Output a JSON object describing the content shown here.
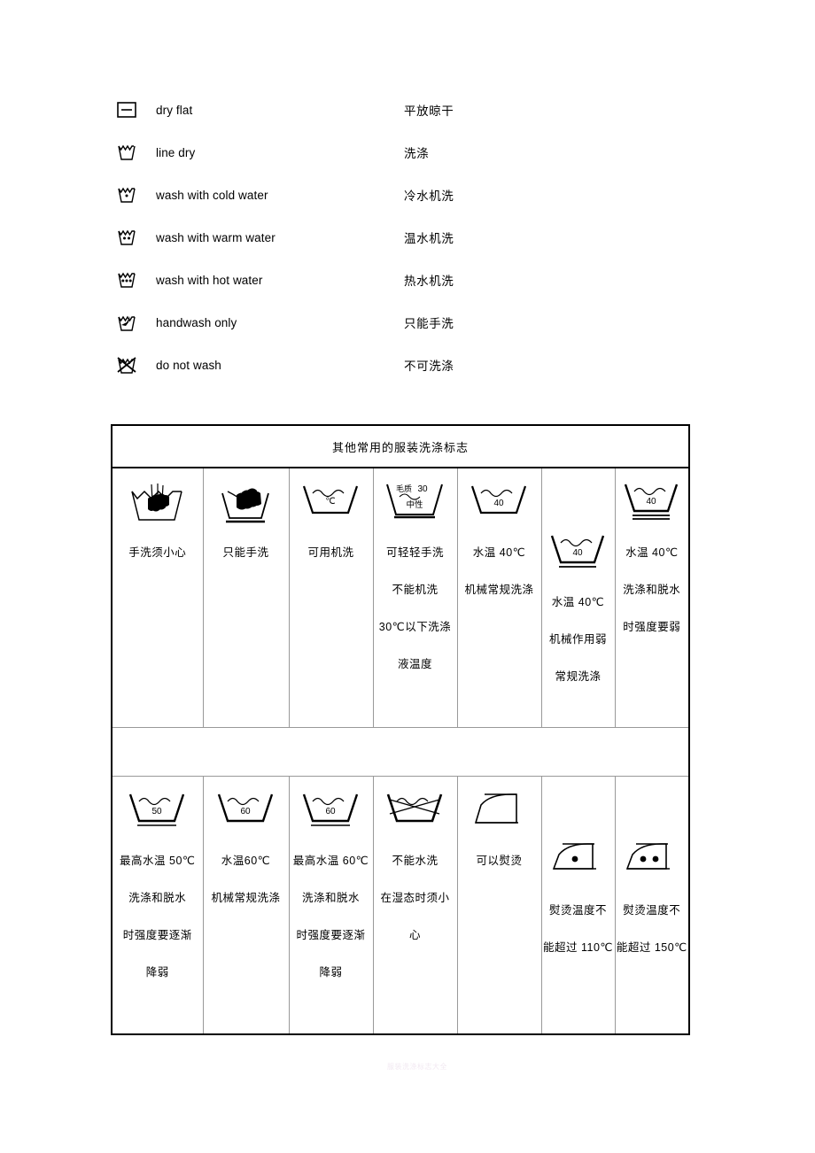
{
  "symbol_list": [
    {
      "icon": "dry-flat-icon",
      "en": "dry flat",
      "zh": "平放晾干"
    },
    {
      "icon": "line-dry-icon",
      "en": "line dry",
      "zh": "洗涤"
    },
    {
      "icon": "wash-cold-water-icon",
      "en": "wash with cold water",
      "zh": "冷水机洗"
    },
    {
      "icon": "wash-warm-water-icon",
      "en": "wash with warm water",
      "zh": "温水机洗"
    },
    {
      "icon": "wash-hot-water-icon",
      "en": "wash with hot water",
      "zh": "热水机洗"
    },
    {
      "icon": "handwash-only-icon",
      "en": "handwash only",
      "zh": "只能手洗"
    },
    {
      "icon": "do-not-wash-icon",
      "en": "do not wash",
      "zh": "不可洗涤"
    }
  ],
  "table": {
    "title": "其他常用的服装洗涤标志",
    "row1": [
      {
        "icon": "hand-in-basin-icon",
        "icon_label": "",
        "lines": [
          "手洗须小心"
        ]
      },
      {
        "icon": "hand-over-basin-icon",
        "icon_label": "",
        "lines": [
          "只能手洗"
        ]
      },
      {
        "icon": "machine-wash-icon",
        "icon_label": "℃",
        "lines": [
          "可用机洗"
        ]
      },
      {
        "icon": "wool-30-neutral-icon",
        "icon_label": "毛质 30 中性",
        "lines": [
          "可轻轻手洗",
          "不能机洗",
          "30℃以下洗涤",
          "液温度"
        ]
      },
      {
        "icon": "basin-40-icon",
        "icon_label": "40",
        "lines": [
          "水温 40℃",
          "机械常规洗涤"
        ]
      },
      {
        "icon": "basin-40-one-bar-icon",
        "icon_label": "40",
        "lines": [
          "水温 40℃",
          "机械作用弱",
          "常规洗涤"
        ]
      },
      {
        "icon": "basin-40-two-bar-icon",
        "icon_label": "40",
        "lines": [
          "水温 40℃",
          "洗涤和脱水",
          "时强度要弱"
        ]
      }
    ],
    "row2": [
      {
        "icon": "basin-50-one-bar-icon",
        "icon_label": "50",
        "lines": [
          "最高水温 50℃",
          "洗涤和脱水",
          "时强度要逐渐",
          "降弱"
        ]
      },
      {
        "icon": "basin-60-icon",
        "icon_label": "60",
        "lines": [
          "水温60℃",
          "机械常规洗涤"
        ]
      },
      {
        "icon": "basin-60-one-bar-icon",
        "icon_label": "60",
        "lines": [
          "最高水温 60℃",
          "洗涤和脱水",
          "时强度要逐渐",
          "降弱"
        ]
      },
      {
        "icon": "do-not-wash-basin-icon",
        "icon_label": "",
        "lines": [
          "不能水洗",
          "在湿态时须小",
          "心"
        ]
      },
      {
        "icon": "iron-icon",
        "icon_label": "",
        "lines": [
          "可以熨烫"
        ]
      },
      {
        "icon": "iron-one-dot-icon",
        "icon_label": "•",
        "lines": [
          "熨烫温度不",
          "能超过 110℃"
        ]
      },
      {
        "icon": "iron-two-dot-icon",
        "icon_label": "••",
        "lines": [
          "熨烫温度不",
          "能超过 150℃"
        ]
      }
    ]
  },
  "watermark": "服装洗涤标志大全"
}
